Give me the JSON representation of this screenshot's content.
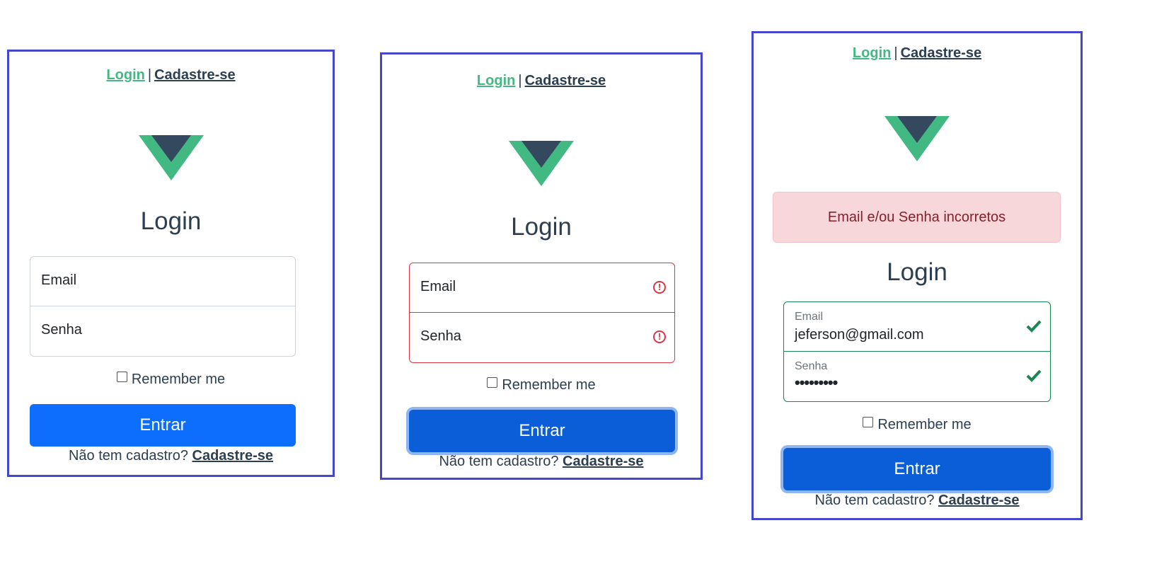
{
  "nav": {
    "login": "Login",
    "separator": "|",
    "signup": "Cadastre-se"
  },
  "form": {
    "title": "Login",
    "email_placeholder": "Email",
    "password_placeholder": "Senha",
    "remember": "Remember me",
    "submit": "Entrar",
    "no_account": "Não tem cadastro?",
    "signup_link": "Cadastre-se"
  },
  "panels": [
    {
      "state": "empty"
    },
    {
      "state": "invalid"
    },
    {
      "state": "valid",
      "alert": "Email e/ou Senha incorretos",
      "email_label": "Email",
      "email_value": "jeferson@gmail.com",
      "password_label": "Senha",
      "password_value": "•••••••••"
    }
  ],
  "icons": {
    "error": "exclamation-circle-icon",
    "valid": "check-icon",
    "logo": "vue-logo"
  },
  "colors": {
    "panel_border": "#4646c8",
    "vue_green": "#42b983",
    "vue_dark": "#35495e",
    "primary": "#0d6efd",
    "danger": "#dc3545",
    "success": "#198754",
    "alert_bg": "#f8d7da",
    "alert_text": "#842029"
  }
}
